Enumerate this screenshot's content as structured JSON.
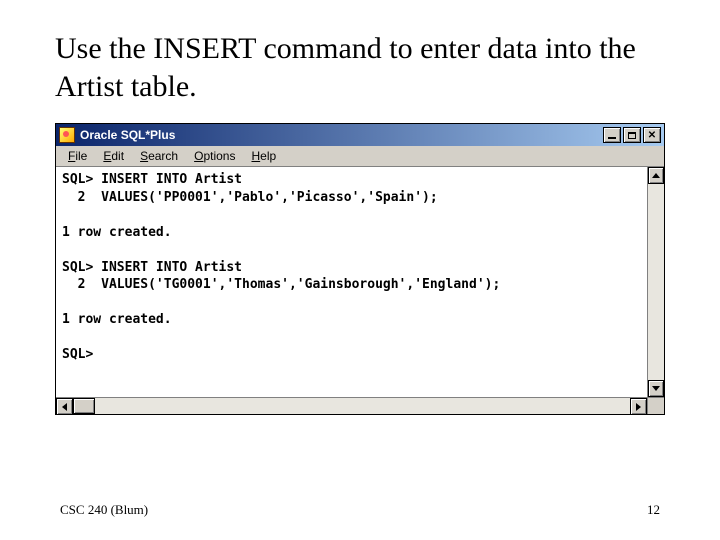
{
  "slide": {
    "title": "Use the INSERT command to enter data into the Artist table.",
    "footer_left": "CSC 240 (Blum)",
    "footer_right": "12"
  },
  "window": {
    "title": "Oracle SQL*Plus",
    "menus": [
      "File",
      "Edit",
      "Search",
      "Options",
      "Help"
    ],
    "content": "SQL> INSERT INTO Artist\n  2  VALUES('PP0001','Pablo','Picasso','Spain');\n\n1 row created.\n\nSQL> INSERT INTO Artist\n  2  VALUES('TG0001','Thomas','Gainsborough','England');\n\n1 row created.\n\nSQL>"
  }
}
